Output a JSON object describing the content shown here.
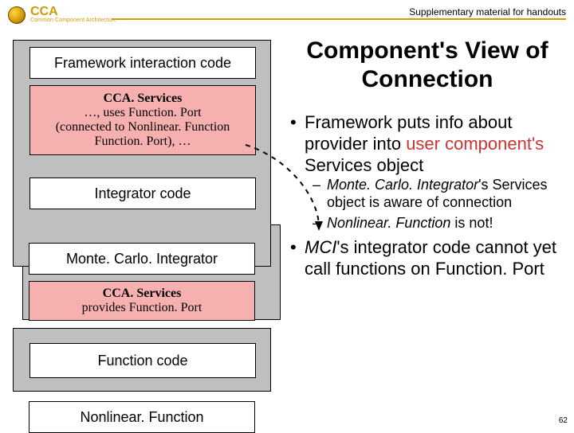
{
  "brand": {
    "text": "CCA",
    "sub": "Common Component Architecture"
  },
  "supplementary": "Supplementary material for handouts",
  "diagram": {
    "framework": "Framework interaction code",
    "services1_title": "CCA. Services",
    "services1_l2": "…, uses Function. Port",
    "services1_l3": "(connected to Nonlinear. Function",
    "services1_l4": "Function. Port), …",
    "integrator": "Integrator code",
    "mci": "Monte. Carlo. Integrator",
    "services2_title": "CCA. Services",
    "services2_l2": "provides Function. Port",
    "function": "Function code",
    "nonlinear": "Nonlinear. Function"
  },
  "title": "Component's View of Connection",
  "bul1_a": "Framework puts info about provider into ",
  "bul1_user": "user component's",
  "bul1_b": " Services object",
  "sub1_a": "Monte. Carlo. Integrator",
  "sub1_b": "'s Services object is aware of connection",
  "sub2_a": "Nonlinear. Function",
  "sub2_b": " is not!",
  "bul2_a": "MCI",
  "bul2_b": "'s integrator code cannot yet call functions on Function. Port",
  "pagenum": "62"
}
